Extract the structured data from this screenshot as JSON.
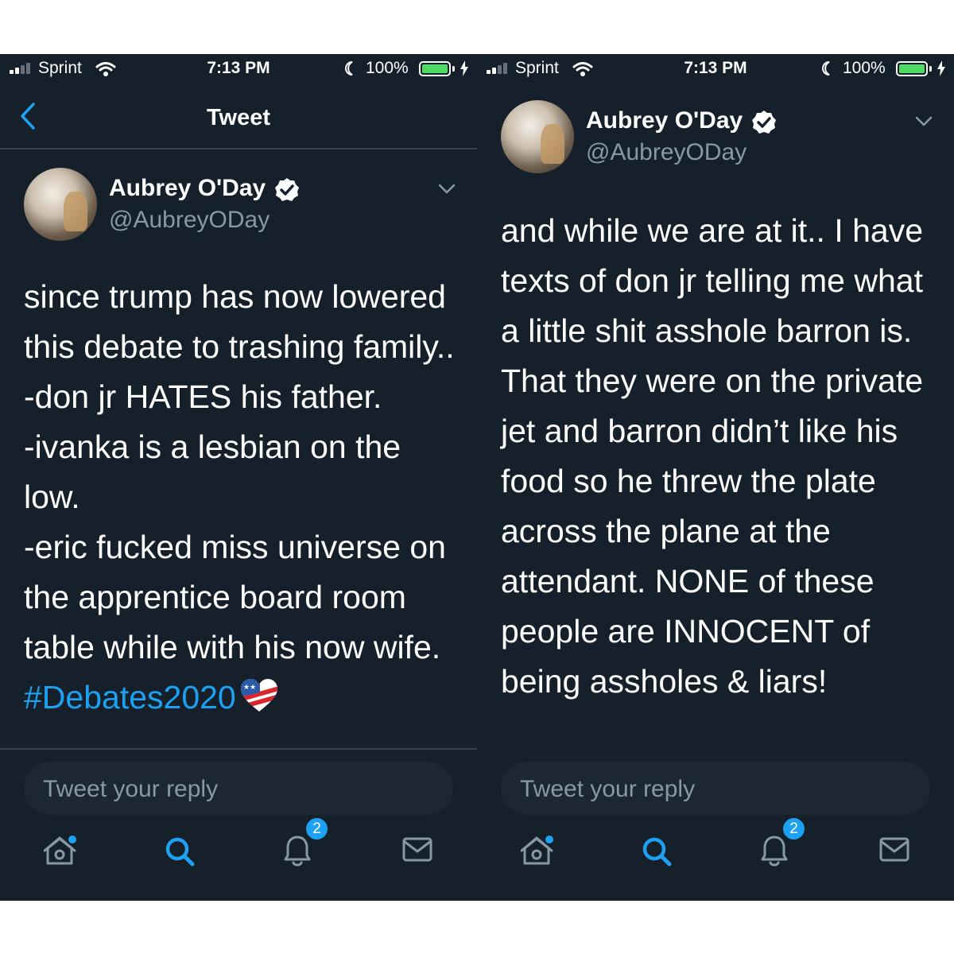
{
  "status_bar": {
    "carrier": "Sprint",
    "time": "7:13 PM",
    "battery": "100%",
    "battery_level": 1.0,
    "icons": [
      "signal-icon",
      "wifi-icon",
      "moon-icon",
      "battery-icon",
      "charging-bolt-icon"
    ]
  },
  "left": {
    "header_title": "Tweet",
    "author": {
      "name": "Aubrey O'Day",
      "handle": "@AubreyODay"
    },
    "tweet_lines": [
      "since trump has now lowered",
      "this debate to trashing family..",
      "-don jr HATES his father.",
      "-ivanka is a lesbian on the",
      "low.",
      "-eric fucked miss universe on",
      "the apprentice board room",
      "table while with his now wife."
    ],
    "hashtag": "#Debates2020",
    "reply_placeholder": "Tweet your reply",
    "notification_count": "2"
  },
  "right": {
    "author": {
      "name": "Aubrey O'Day",
      "handle": "@AubreyODay"
    },
    "tweet_lines": [
      "and while we are at it.. I have",
      "texts of don jr telling me what",
      "a little shit asshole barron is.",
      "That they were on the private",
      "jet and barron didn’t like his",
      "food so he threw the plate",
      "across the plane at the",
      "attendant. NONE of these",
      "people are INNOCENT of",
      "being assholes & liars!"
    ],
    "reply_placeholder": "Tweet your reply",
    "notification_count": "2"
  },
  "tab_icons": [
    "home-icon",
    "search-icon",
    "notifications-icon",
    "messages-icon"
  ],
  "colors": {
    "background": "#15202b",
    "accent": "#1da1f2",
    "secondary_text": "#8899a6",
    "divider": "#38444d",
    "battery": "#4cd964"
  }
}
